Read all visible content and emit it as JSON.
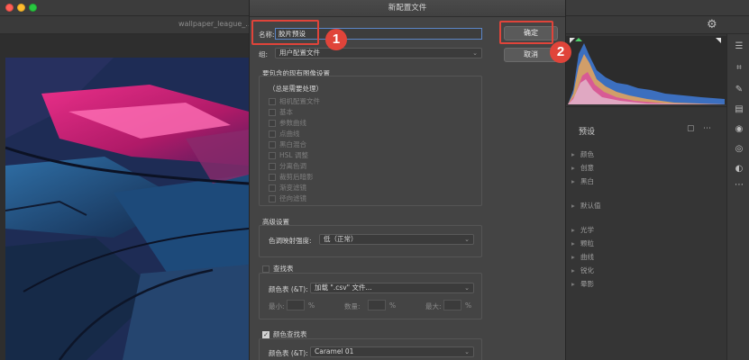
{
  "window": {
    "filename": "wallpaper_league_..."
  },
  "dialog": {
    "title": "新配置文件",
    "name_label": "名称:",
    "name_value": "胶片预设",
    "group_label": "组:",
    "group_value": "用户配置文件",
    "ok_button": "确定",
    "cancel_button": "取消",
    "settings_section": "要包含的现有图像设置",
    "settings_note": "（总是需要处理）",
    "settings_items": [
      "相机配置文件",
      "基本",
      "参数曲线",
      "点曲线",
      "黑白混合",
      "HSL 调整",
      "分离色调",
      "裁剪后暗影",
      "渐变滤镜",
      "径向滤镜"
    ],
    "advanced_section": "高级设置",
    "tone_label": "色调映射强度:",
    "tone_value": "低（正常）",
    "lookup_label": "查找表",
    "lookup_table_label": "颜色表 (&T):",
    "lookup_table_value": "加载 \".csv\" 文件...",
    "min_label": "最小:",
    "amount_label": "数量:",
    "max_label": "最大:",
    "percent": "%",
    "color_lookup_label": "颜色查找表",
    "color_table_label": "颜色表 (&T):",
    "color_table_value": "Caramel 01"
  },
  "annotations": {
    "one": "1",
    "two": "2"
  },
  "presets": {
    "title": "预设",
    "items": [
      "颜色",
      "创意",
      "黑白",
      "默认值",
      "光学",
      "颗粒",
      "曲线",
      "锐化",
      "晕影"
    ]
  },
  "colors": {
    "annotation": "#e0443a",
    "input_focus": "#5b86c7"
  }
}
